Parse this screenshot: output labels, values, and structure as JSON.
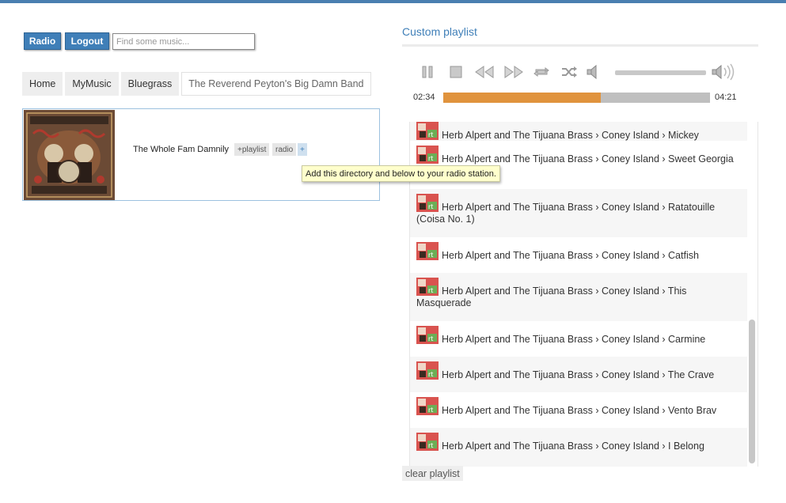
{
  "nav": {
    "radio_label": "Radio",
    "logout_label": "Logout",
    "search_placeholder": "Find some music..."
  },
  "breadcrumbs": [
    "Home",
    "MyMusic",
    "Bluegrass",
    "The Reverend Peyton's Big Damn Band"
  ],
  "album": {
    "title": "The Whole Fam Damnily",
    "playlist_tag": "+playlist",
    "radio_tag": "radio",
    "plus_tag": "+"
  },
  "tooltip": "Add this directory and below to your radio station.",
  "playlist": {
    "title": "Custom playlist",
    "elapsed": "02:34",
    "total": "04:21",
    "progress": 0.59,
    "controls": [
      "pause-icon",
      "stop-icon",
      "rewind-icon",
      "fast-forward-icon",
      "repeat-icon",
      "shuffle-icon",
      "volume-low-icon",
      "volume-high-icon"
    ],
    "items": [
      {
        "text": "Herb Alpert and The Tijuana Brass › Coney Island › Mickey"
      },
      {
        "text": "Herb Alpert and The Tijuana Brass › Coney Island › Sweet Georgia Brown"
      },
      {
        "text": "Herb Alpert and The Tijuana Brass › Coney Island › Ratatouille (Coisa No. 1)"
      },
      {
        "text": "Herb Alpert and The Tijuana Brass › Coney Island › Catfish"
      },
      {
        "text": "Herb Alpert and The Tijuana Brass › Coney Island › This Masquerade"
      },
      {
        "text": "Herb Alpert and The Tijuana Brass › Coney Island › Carmine"
      },
      {
        "text": "Herb Alpert and The Tijuana Brass › Coney Island › The Crave"
      },
      {
        "text": "Herb Alpert and The Tijuana Brass › Coney Island › Vento Brav"
      },
      {
        "text": "Herb Alpert and The Tijuana Brass › Coney Island › I Belong"
      }
    ],
    "clear_label": "clear playlist"
  },
  "colors": {
    "accent": "#3f7fb8",
    "progress": "#e0933d",
    "tooltip_bg": "#ffffcc"
  }
}
